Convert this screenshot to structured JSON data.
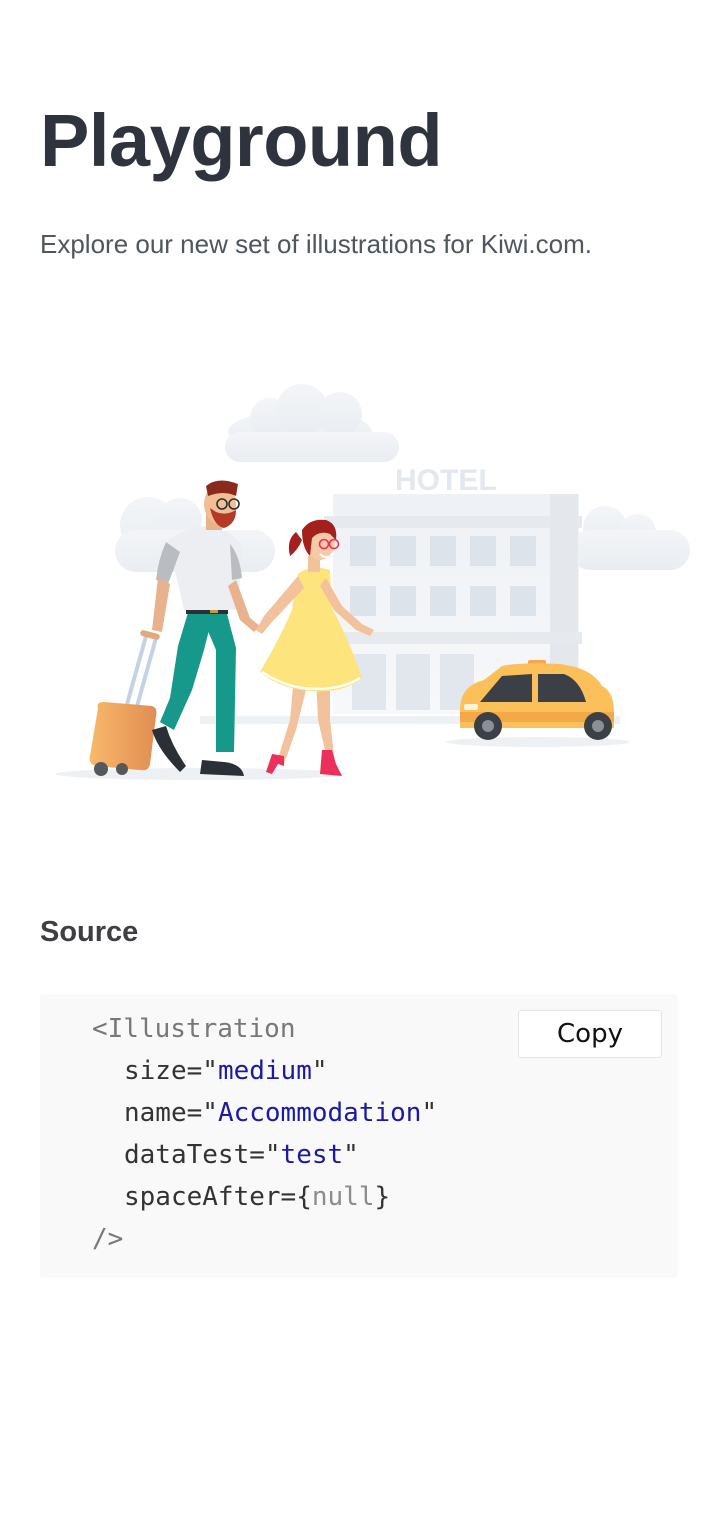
{
  "page": {
    "title": "Playground",
    "subtitle": "Explore our new set of illustrations for Kiwi.com."
  },
  "illustration": {
    "name": "Accommodation",
    "hotel_sign": "HOTEL",
    "icons": [
      "cloud",
      "hotel-building",
      "couple-walking",
      "suitcase",
      "taxi-car"
    ]
  },
  "source": {
    "heading": "Source",
    "copy_label": "Copy",
    "code": {
      "open_tag": "<Illustration",
      "props": [
        {
          "name": "size",
          "eq": "=\"",
          "value": "medium",
          "end": "\""
        },
        {
          "name": "name",
          "eq": "=\"",
          "value": "Accommodation",
          "end": "\""
        },
        {
          "name": "dataTest",
          "eq": "=\"",
          "value": "test",
          "end": "\""
        },
        {
          "name": "spaceAfter",
          "eq": "={",
          "value": "null",
          "end": "}"
        }
      ],
      "close_tag": "/>"
    }
  },
  "colors": {
    "heading": "#2e333d",
    "code_background": "#f9f9f9",
    "string_token": "#1a1aa6",
    "tag_token": "#77787a",
    "taxi": "#fbc05a",
    "dress": "#fde47c",
    "trousers": "#16998b"
  }
}
